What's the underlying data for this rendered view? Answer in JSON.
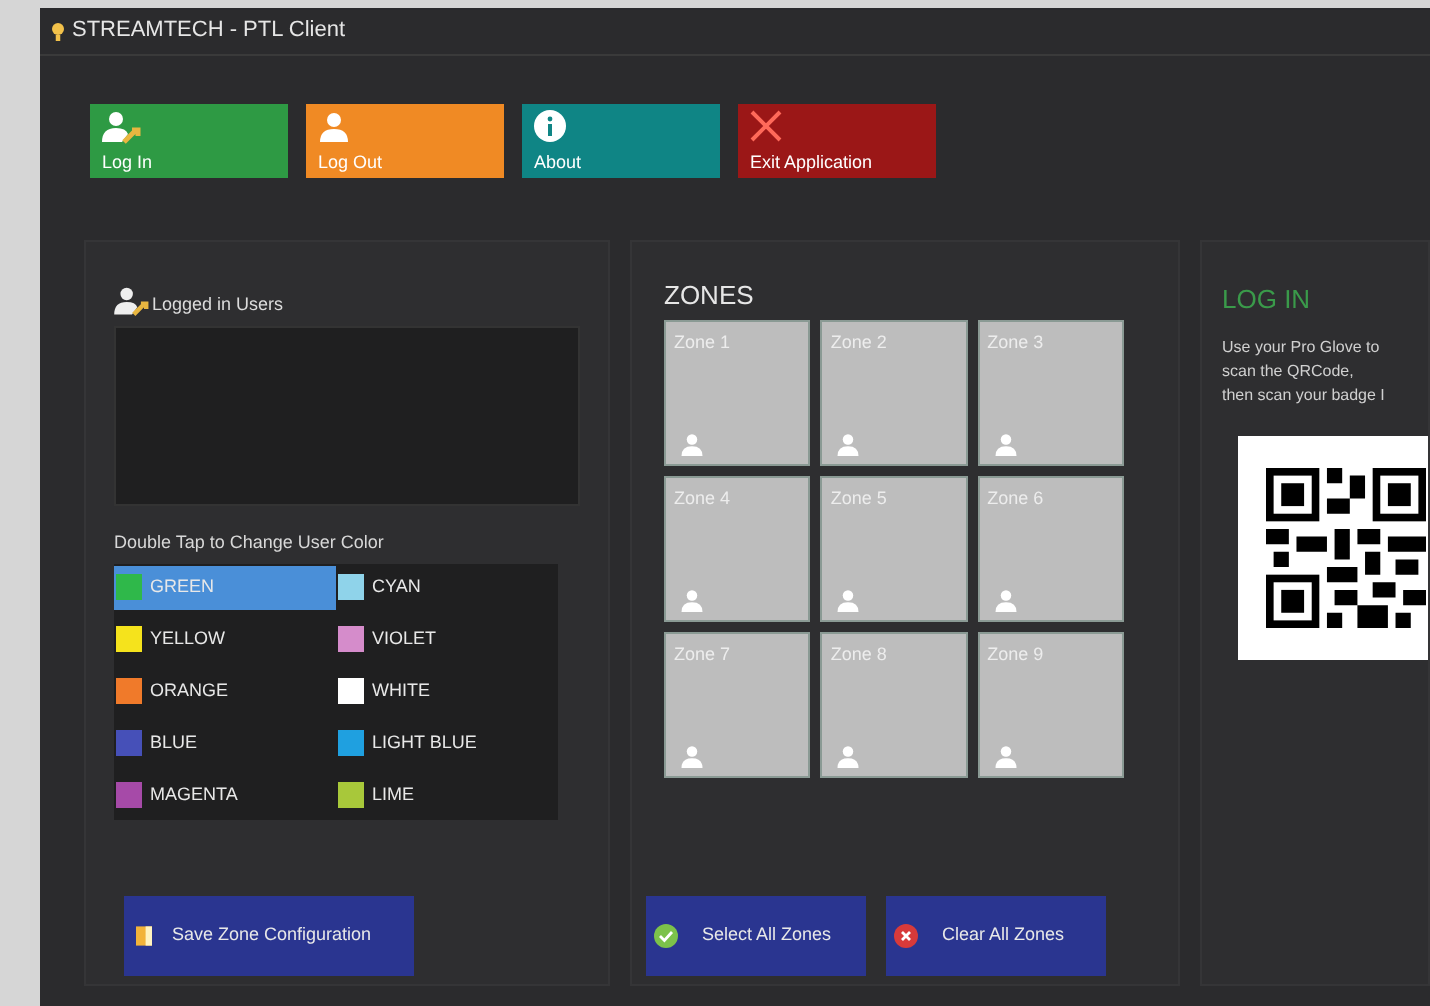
{
  "window": {
    "title": "STREAMTECH - PTL Client"
  },
  "toolbar": [
    {
      "label": "Log In",
      "kind": "login",
      "color": "#2e9a44"
    },
    {
      "label": "Log Out",
      "kind": "logout",
      "color": "#f08a24"
    },
    {
      "label": "About",
      "kind": "about",
      "color": "#0f8585"
    },
    {
      "label": "Exit Application",
      "kind": "exit",
      "color": "#9b1717"
    }
  ],
  "users_panel": {
    "title": "Logged in Users",
    "color_hint": "Double Tap to Change User Color",
    "colors": [
      {
        "label": "GREEN",
        "color": "#2fb84a",
        "selected": true
      },
      {
        "label": "CYAN",
        "color": "#8fd3ea",
        "selected": false
      },
      {
        "label": "YELLOW",
        "color": "#f5e31c",
        "selected": false
      },
      {
        "label": "VIOLET",
        "color": "#d58ccb",
        "selected": false
      },
      {
        "label": "ORANGE",
        "color": "#f07a2a",
        "selected": false
      },
      {
        "label": "WHITE",
        "color": "#ffffff",
        "selected": false
      },
      {
        "label": "BLUE",
        "color": "#4650b8",
        "selected": false
      },
      {
        "label": "LIGHT BLUE",
        "color": "#1fa0e0",
        "selected": false
      },
      {
        "label": "MAGENTA",
        "color": "#a64aa8",
        "selected": false
      },
      {
        "label": "LIME",
        "color": "#a8c83a",
        "selected": false
      }
    ],
    "save_button": "Save Zone Configuration"
  },
  "zones_panel": {
    "title": "ZONES",
    "zones": [
      "Zone 1",
      "Zone 2",
      "Zone 3",
      "Zone 4",
      "Zone 5",
      "Zone 6",
      "Zone 7",
      "Zone 8",
      "Zone 9"
    ],
    "buttons": [
      {
        "label": "Select All Zones",
        "kind": "select"
      },
      {
        "label": "Clear All Zones",
        "kind": "clear"
      }
    ]
  },
  "login_panel": {
    "title": "LOG IN",
    "lines": [
      "Use your Pro Glove to",
      "scan the QRCode,",
      "then scan your badge I"
    ]
  }
}
